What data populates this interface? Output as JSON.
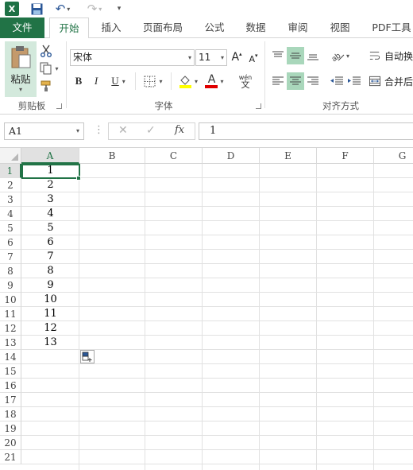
{
  "qat": {
    "excel_logo": "X",
    "icons": [
      "excel-icon",
      "save-icon",
      "undo-icon",
      "redo-icon",
      "customize-qat-icon"
    ]
  },
  "tabs": {
    "file": "文件",
    "home": "开始",
    "insert": "插入",
    "page_layout": "页面布局",
    "formulas": "公式",
    "data": "数据",
    "review": "审阅",
    "view": "视图",
    "pdf_tools": "PDF工具"
  },
  "ribbon": {
    "clipboard": {
      "paste_label": "粘贴",
      "group_label": "剪贴板"
    },
    "font": {
      "font_name": "宋体",
      "font_size": "11",
      "grow_font": "A",
      "shrink_font": "A",
      "bold": "B",
      "italic": "I",
      "underline": "U",
      "phonetic_top": "wén",
      "phonetic_bottom": "文",
      "font_color_letter": "A",
      "group_label": "字体"
    },
    "alignment": {
      "wrap_text": "自动换",
      "merge_center": "合并后",
      "group_label": "对齐方式"
    },
    "colors": {
      "accent": "#217346",
      "selected_button": "#a9d7bb",
      "fill_color": "#ffff00",
      "font_color": "#e00000"
    }
  },
  "formula_bar": {
    "name_box": "A1",
    "cancel_symbol": "✕",
    "enter_symbol": "✓",
    "fx_label": "fx",
    "value": "1"
  },
  "sheet": {
    "columns": [
      "A",
      "B",
      "C",
      "D",
      "E",
      "F",
      "G"
    ],
    "rows": [
      "1",
      "2",
      "3",
      "4",
      "5",
      "6",
      "7",
      "8",
      "9",
      "10",
      "11",
      "12",
      "13",
      "14",
      "15",
      "16",
      "17",
      "18",
      "19",
      "20",
      "21"
    ],
    "col_a_values": [
      "1",
      "2",
      "3",
      "4",
      "5",
      "6",
      "7",
      "8",
      "9",
      "10",
      "11",
      "12",
      "13"
    ],
    "active_cell": "A1"
  }
}
